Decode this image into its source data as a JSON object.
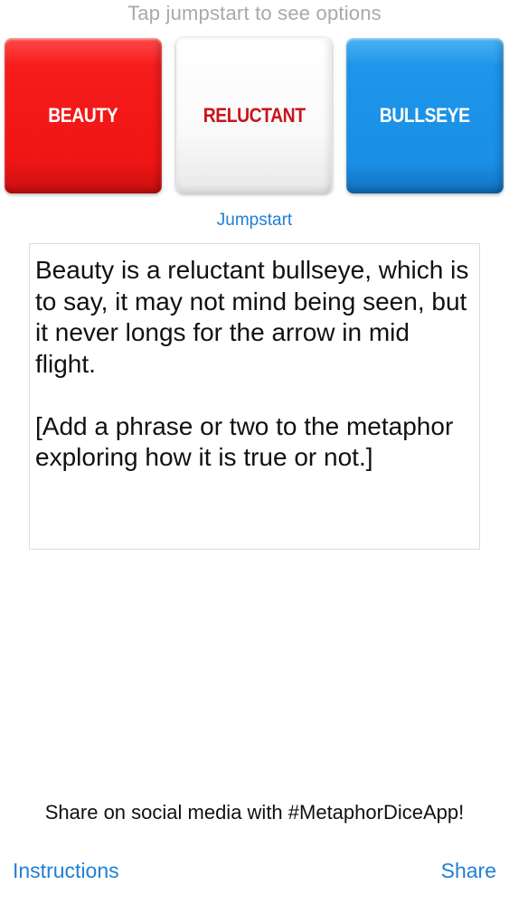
{
  "hint": "Tap jumpstart to see options",
  "dice": [
    {
      "label": "BEAUTY",
      "color": "#f21a1a"
    },
    {
      "label": "RELUCTANT",
      "color": "#ffffff"
    },
    {
      "label": "BULLSEYE",
      "color": "#1a8fe5"
    }
  ],
  "jumpstart_label": "Jumpstart",
  "editor": {
    "text": "Beauty is a reluctant bullseye, which is to say, it may not mind being seen, but it never longs for the arrow in mid flight.\n\n[Add a phrase or two to the metaphor exploring how it is true or not.]"
  },
  "share_message": "Share on social media with #MetaphorDiceApp!",
  "bottom_bar": {
    "instructions_label": "Instructions",
    "share_label": "Share"
  },
  "colors": {
    "accent": "#1f7fd6",
    "hint_text": "#a9a9ad"
  }
}
